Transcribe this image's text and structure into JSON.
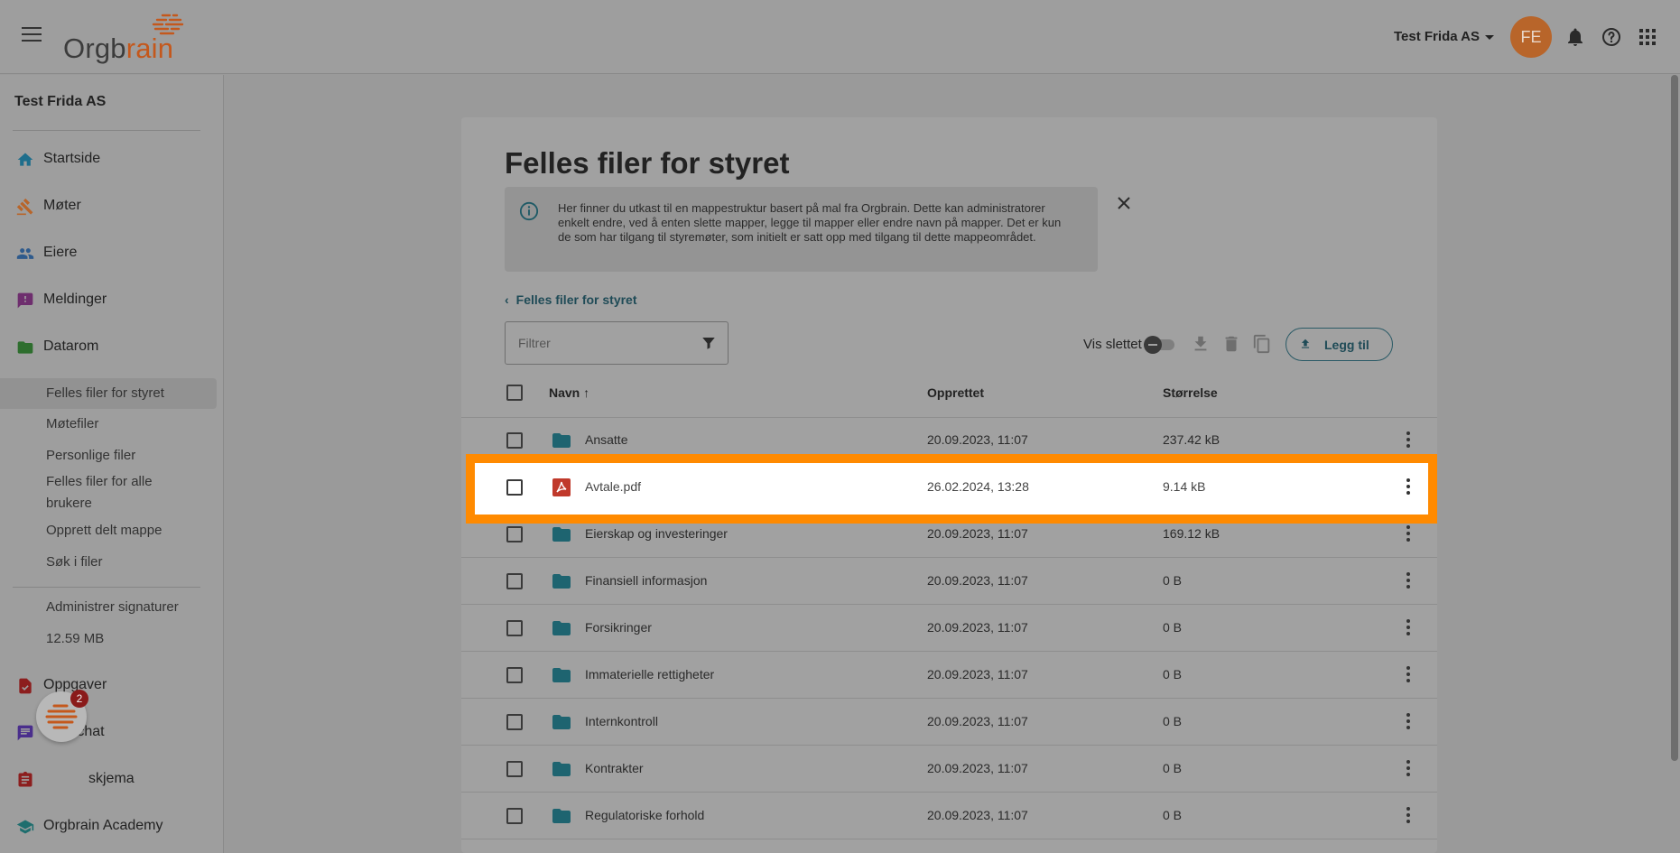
{
  "header": {
    "logo_text_main": "Orgb",
    "logo_text_accent": "rain",
    "company": "Test Frida AS",
    "avatar_initials": "FE",
    "icons": [
      "menu-icon",
      "bell-icon",
      "help-icon",
      "apps-grid-icon"
    ]
  },
  "sidebar": {
    "org_name": "Test Frida AS",
    "items": [
      {
        "label": "Startside",
        "icon": "home-icon",
        "color": "#1e6e8c"
      },
      {
        "label": "Møter",
        "icon": "gavel-icon",
        "color": "#b8652a"
      },
      {
        "label": "Eiere",
        "icon": "people-icon",
        "color": "#2e5a8c"
      },
      {
        "label": "Meldinger",
        "icon": "message-alert-icon",
        "color": "#6e2e6e"
      },
      {
        "label": "Datarom",
        "icon": "folder-icon",
        "color": "#2e6e2e"
      }
    ],
    "sub_items": [
      "Felles filer for styret",
      "Møtefiler",
      "Personlige filer",
      "Felles filer for alle",
      "brukere",
      "Opprett delt mappe",
      "Søk i filer"
    ],
    "sub_items2": [
      "Administrer signaturer",
      "12.59 MB"
    ],
    "items_bottom": [
      {
        "label": "Oppgaver",
        "icon": "task-icon",
        "color": "#8c1e1e"
      },
      {
        "label": "Styrechat",
        "icon": "chat-icon",
        "color": "#4a2e8c"
      },
      {
        "label": "skjema",
        "icon": "form-icon",
        "color": "#8c1e1e"
      },
      {
        "label": "Orgbrain Academy",
        "icon": "school-icon",
        "color": "#1e6e6e"
      }
    ],
    "chat_badge": "2"
  },
  "main": {
    "title": "Felles filer for styret",
    "info": "Her finner du utkast til en mappestruktur basert på mal fra Orgbrain. Dette kan administratorer enkelt endre, ved å enten slette mapper, legge til mapper eller endre navn på mapper. Det er kun de som har tilgang til styremøter, som initielt er satt opp med tilgang til dette mappeområdet.",
    "breadcrumb": "Felles filer for styret",
    "filter_placeholder": "Filtrer",
    "vis_slettet": "Vis slettet",
    "add_button": "Legg til",
    "columns": {
      "name": "Navn",
      "created": "Opprettet",
      "size": "Størrelse"
    },
    "rows": [
      {
        "name": "Ansatte",
        "type": "folder",
        "created": "20.09.2023, 11:07",
        "size": "237.42 kB"
      },
      {
        "name": "Avtale.pdf",
        "type": "pdf",
        "created": "26.02.2024, 13:28",
        "size": "9.14 kB",
        "highlighted": true
      },
      {
        "name": "Eierskap og investeringer",
        "type": "folder",
        "created": "20.09.2023, 11:07",
        "size": "169.12 kB"
      },
      {
        "name": "Finansiell informasjon",
        "type": "folder",
        "created": "20.09.2023, 11:07",
        "size": "0 B"
      },
      {
        "name": "Forsikringer",
        "type": "folder",
        "created": "20.09.2023, 11:07",
        "size": "0 B"
      },
      {
        "name": "Immaterielle rettigheter",
        "type": "folder",
        "created": "20.09.2023, 11:07",
        "size": "0 B"
      },
      {
        "name": "Internkontroll",
        "type": "folder",
        "created": "20.09.2023, 11:07",
        "size": "0 B"
      },
      {
        "name": "Kontrakter",
        "type": "folder",
        "created": "20.09.2023, 11:07",
        "size": "0 B"
      },
      {
        "name": "Regulatoriske forhold",
        "type": "folder",
        "created": "20.09.2023, 11:07",
        "size": "0 B"
      }
    ],
    "colors": {
      "highlight": "#ff8a00",
      "folder": "#1e6470",
      "pdf": "#c0392b",
      "accent": "#1f4b57"
    }
  }
}
